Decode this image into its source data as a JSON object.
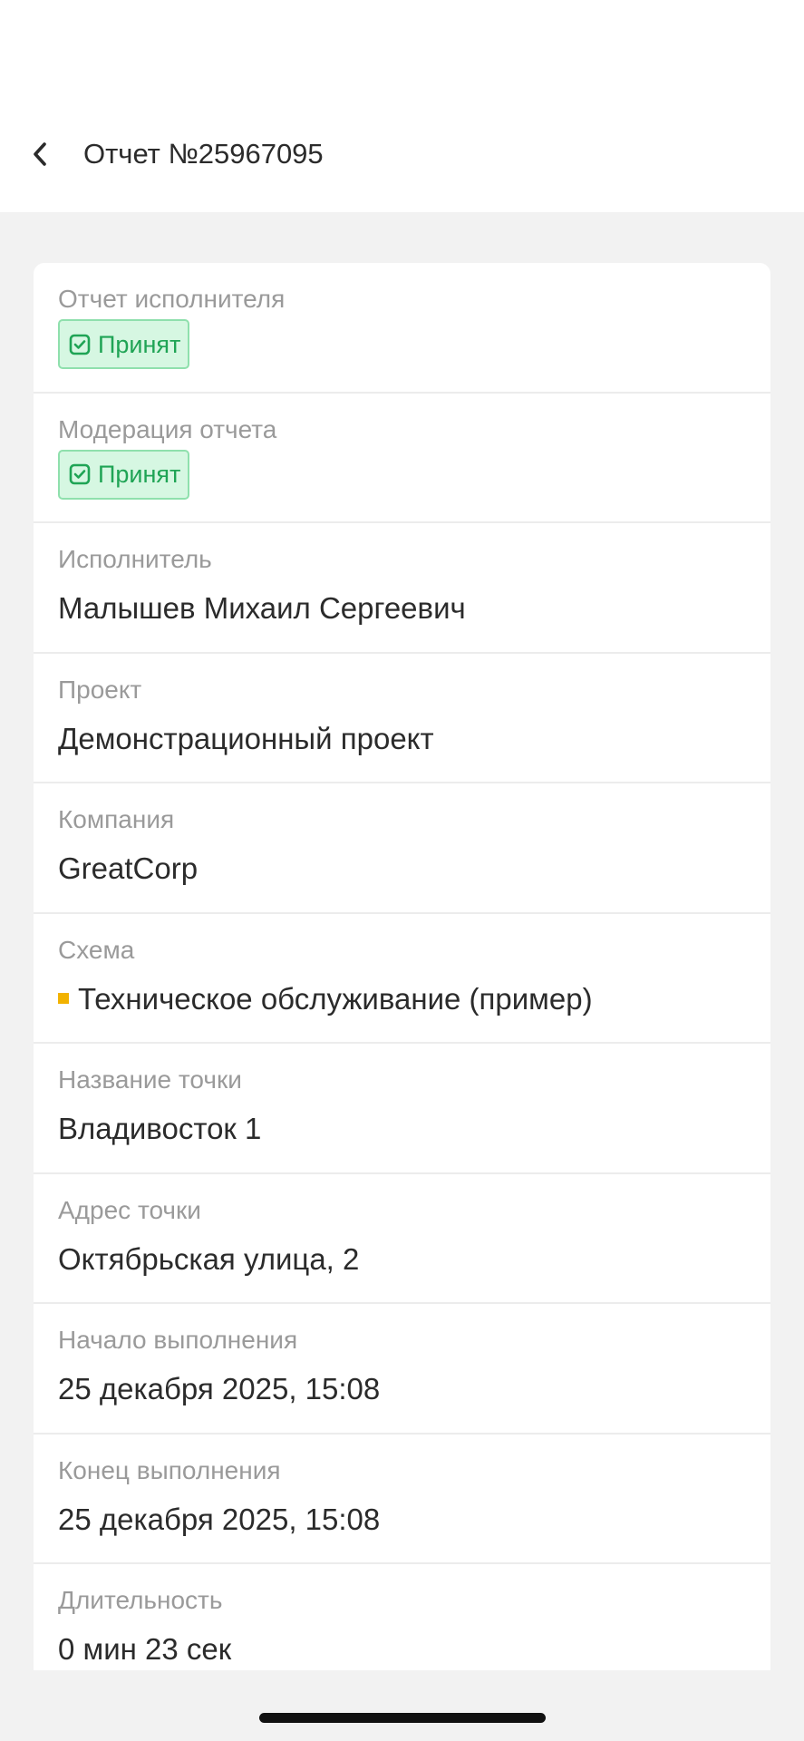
{
  "header": {
    "title": "Отчет №25967095",
    "back_icon": "chevron-left-icon"
  },
  "fields": {
    "executor_report": {
      "label": "Отчет исполнителя",
      "status": "Принят",
      "status_icon": "checkbox-checked-icon"
    },
    "moderation": {
      "label": "Модерация отчета",
      "status": "Принят",
      "status_icon": "checkbox-checked-icon"
    },
    "executor": {
      "label": "Исполнитель",
      "value": "Малышев Михаил Сергеевич"
    },
    "project": {
      "label": "Проект",
      "value": "Демонстрационный проект"
    },
    "company": {
      "label": "Компания",
      "value": "GreatCorp"
    },
    "scheme": {
      "label": "Схема",
      "value": "Техническое обслуживание (пример)",
      "marker_color": "#f2b200"
    },
    "point_name": {
      "label": "Название точки",
      "value": "Владивосток 1"
    },
    "point_address": {
      "label": "Адрес точки",
      "value": "Октябрьская улица, 2"
    },
    "start": {
      "label": "Начало выполнения",
      "value": "25 декабря 2025, 15:08"
    },
    "end": {
      "label": "Конец выполнения",
      "value": "25 декабря 2025, 15:08"
    },
    "duration": {
      "label": "Длительность",
      "value": "0 мин 23 сек"
    }
  },
  "colors": {
    "status_green": "#1fa455",
    "status_bg": "#d6f7e2",
    "status_border": "#8fe0ad",
    "page_bg": "#f2f2f2"
  }
}
